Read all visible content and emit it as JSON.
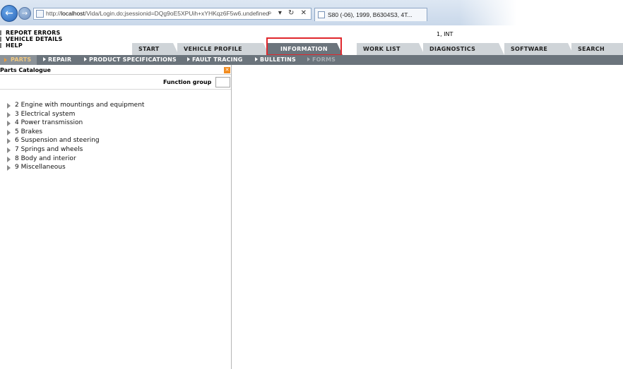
{
  "browser": {
    "url_prefix": "http://",
    "url_host": "localhost",
    "url_path": "/Vida/Login.do;jsessionid=DQg9oE5XPUih+xYHKqz6F5w6.undefined",
    "addr_icons": "⌕ ▾ ↻ ✕",
    "tab_title": "S80 (-06), 1999, B6304S3, 4T...",
    "back_icon": "arrow-left",
    "forward_icon": "arrow-right"
  },
  "top_links": {
    "report": "REPORT ERRORS",
    "vehicle": "VEHICLE DETAILS",
    "help": "HELP"
  },
  "user_info": "1, INT",
  "main_tabs": {
    "start": "START",
    "vehicle_profile": "VEHICLE PROFILE",
    "information": "INFORMATION",
    "work_list": "WORK LIST",
    "diagnostics": "DIAGNOSTICS",
    "software": "SOFTWARE",
    "search": "SEARCH"
  },
  "sub_nav": {
    "parts": "PARTS",
    "repair": "REPAIR",
    "product_specifications": "PRODUCT SPECIFICATIONS",
    "fault_tracing": "FAULT TRACING",
    "bulletins": "BULLETINS",
    "forms": "FORMS"
  },
  "left_panel": {
    "title": "Parts Catalogue",
    "close": "✕",
    "function_group_label": "Function group",
    "function_group_value": "",
    "tree": [
      "2 Engine with mountings and equipment",
      "3 Electrical system",
      "4 Power transmission",
      "5 Brakes",
      "6 Suspension and steering",
      "7 Springs and wheels",
      "8 Body and interior",
      "9 Miscellaneous"
    ]
  },
  "colors": {
    "active_tab": "#6b747c",
    "inactive_tab": "#cfd4d8",
    "highlight_box": "#e0272c",
    "close_icon": "#f28c20"
  }
}
